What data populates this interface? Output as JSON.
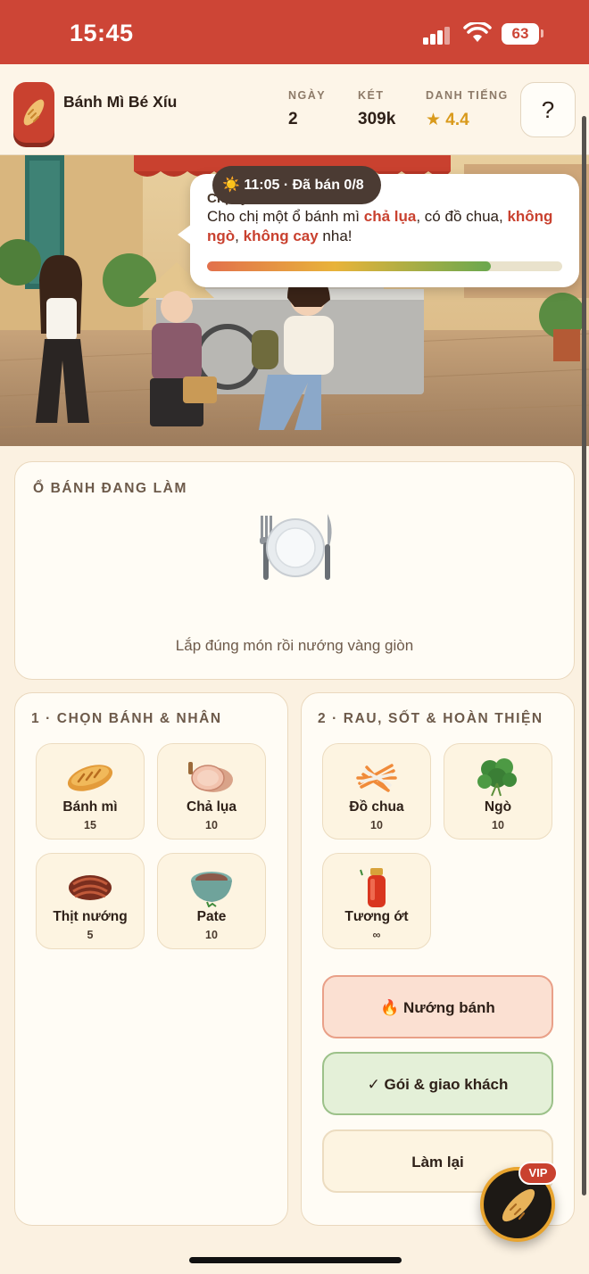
{
  "status_bar": {
    "time": "15:45",
    "battery": "63"
  },
  "header": {
    "brand": "Bánh Mì Bé Xíu",
    "stats": [
      {
        "label": "NGÀY",
        "value": "2"
      },
      {
        "label": "KÉT",
        "value": "309k"
      },
      {
        "label": "DANH TIẾNG",
        "value": "★ 4.4"
      }
    ],
    "help_label": "?"
  },
  "scene": {
    "clock": "☀️ 11:05 · Đã bán 0/8",
    "customer_name": "Chị Vy",
    "message": {
      "t1": "Cho chị một ổ bánh mì ",
      "b1": "chả lụa",
      "t2": ", có đồ chua, ",
      "b2": "không ngò",
      "t3": ", ",
      "b3": "không cay",
      "t4": " nha!"
    },
    "patience": 0.8
  },
  "current_sandwich": {
    "title": "Ổ BÁNH ĐANG LÀM",
    "hint": "Lắp đúng món rồi nướng vàng giòn"
  },
  "bread_panel": {
    "title": "1 · CHỌN BÁNH & NHÂN",
    "items": [
      {
        "name": "Bánh mì",
        "count": "15",
        "icon": "baguette-icon"
      },
      {
        "name": "Chả lụa",
        "count": "10",
        "icon": "cha-lua-icon"
      },
      {
        "name": "Thịt nướng",
        "count": "5",
        "icon": "grilled-pork-icon"
      },
      {
        "name": "Pate",
        "count": "10",
        "icon": "pate-bowl-icon"
      }
    ]
  },
  "veg_panel": {
    "title": "2 · RAU, SỐT & HOÀN THIỆN",
    "items": [
      {
        "name": "Đồ chua",
        "count": "10",
        "icon": "pickles-icon"
      },
      {
        "name": "Ngò",
        "count": "10",
        "icon": "cilantro-icon"
      },
      {
        "name": "Tương ớt",
        "count": "∞",
        "icon": "chili-sauce-icon"
      }
    ]
  },
  "actions": {
    "bake": "🔥 Nướng bánh",
    "pack": "✓ Gói & giao khách",
    "reset": "Làm lại"
  },
  "vip_badge": "VIP",
  "colors": {
    "brand_red": "#cd4536",
    "star_gold": "#d99a1c",
    "cream": "#fbf1e1"
  }
}
